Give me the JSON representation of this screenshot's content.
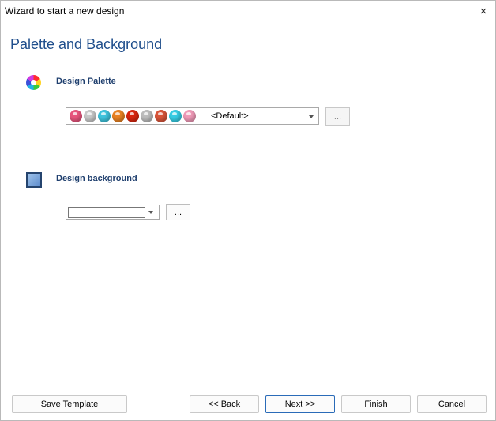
{
  "window": {
    "title": "Wizard to start a new design",
    "close_icon": "×"
  },
  "page": {
    "title": "Palette and Background"
  },
  "palette_section": {
    "label": "Design Palette",
    "icon": "color-wheel-icon",
    "selected": "<Default>",
    "swatches": [
      "#e8557d",
      "#c9c9c9",
      "#3ec4dd",
      "#e98222",
      "#d9260f",
      "#bdbdbd",
      "#d9553a",
      "#36cde4",
      "#f09ab8"
    ],
    "more_label": "..."
  },
  "background_section": {
    "label": "Design background",
    "icon": "background-square-icon",
    "selected": "",
    "more_label": "..."
  },
  "footer": {
    "save_label": "Save Template",
    "back_label": "<< Back",
    "next_label": "Next >>",
    "finish_label": "Finish",
    "cancel_label": "Cancel"
  },
  "colors": {
    "accent": "#1f4e8c",
    "label": "#1f3f6e",
    "focus_border": "#2a6bb8"
  }
}
